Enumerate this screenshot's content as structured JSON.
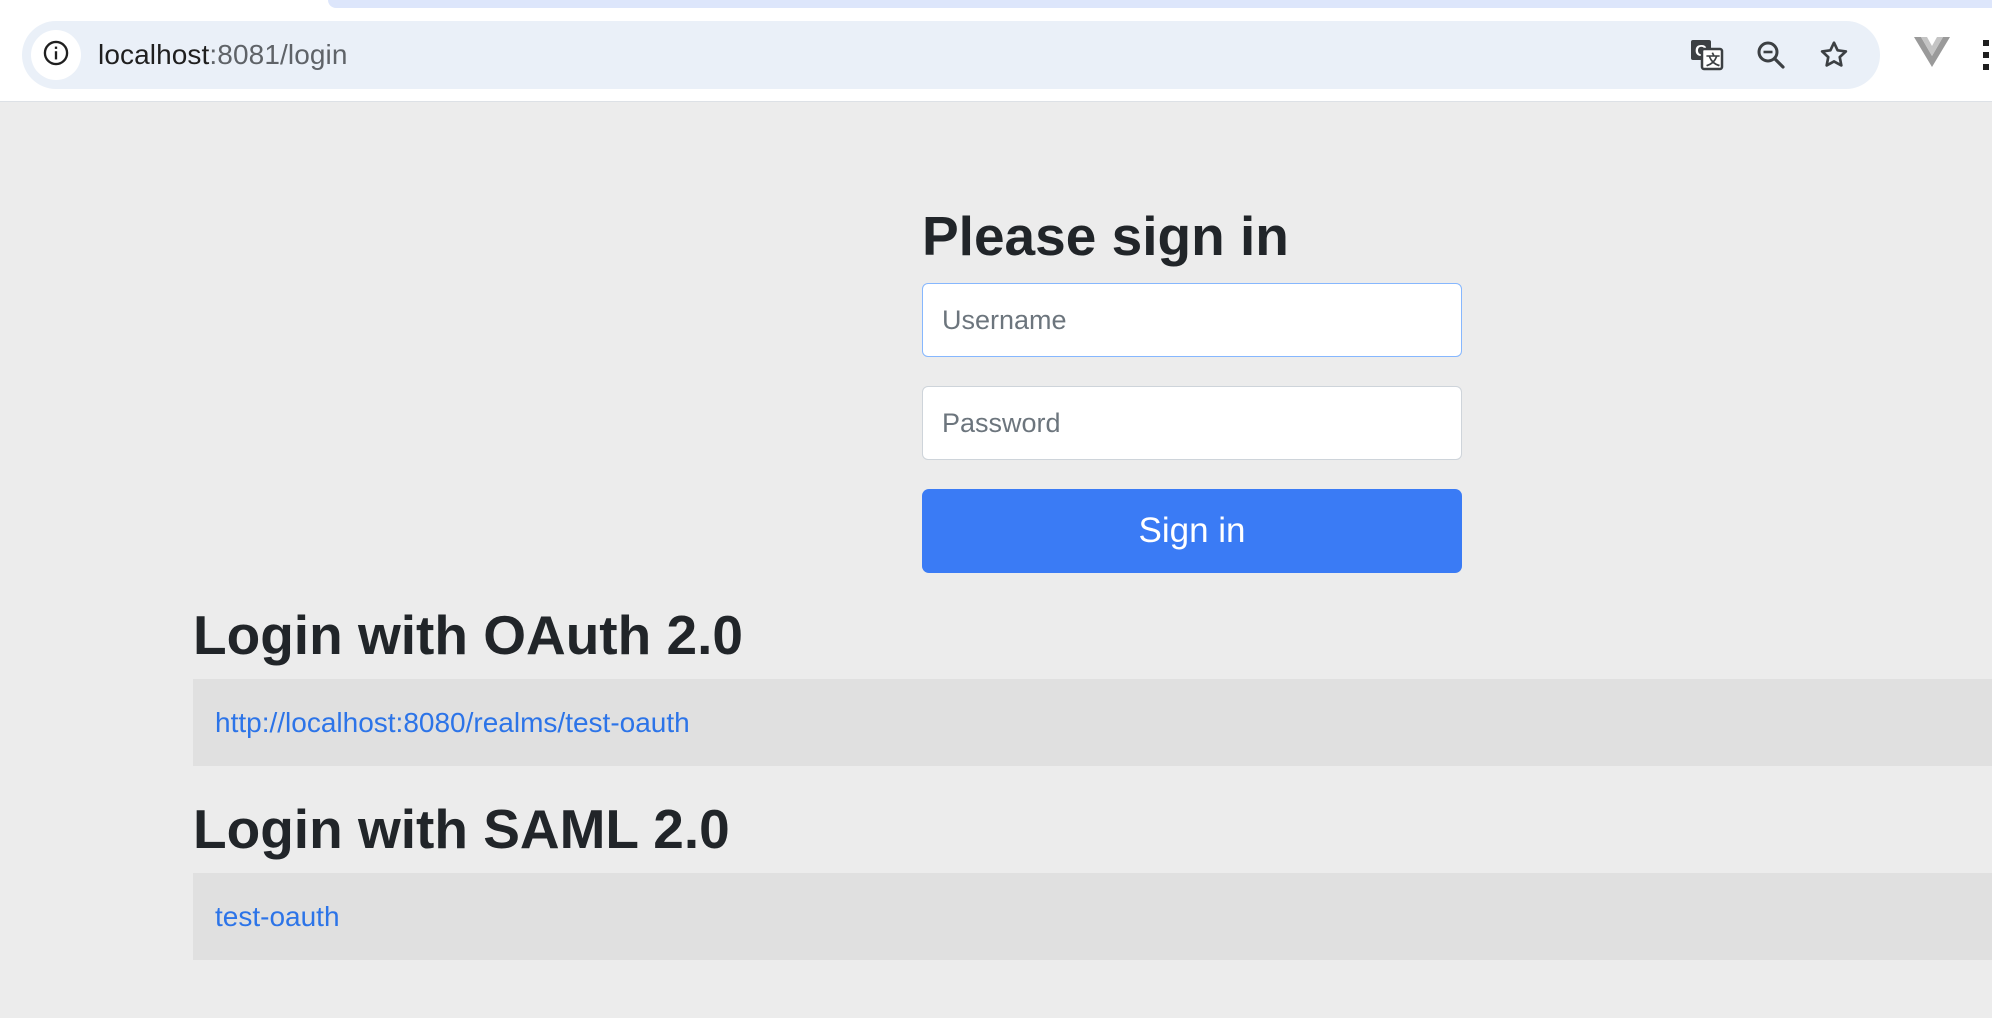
{
  "browser": {
    "url_host": "localhost",
    "url_path": ":8081/login",
    "icons": {
      "site_info": "info-icon",
      "translate": "translate-icon",
      "zoom": "zoom-out-icon",
      "bookmark": "star-icon",
      "extension": "vue-devtools-icon",
      "menu": "kebab-menu-icon"
    }
  },
  "login": {
    "heading": "Please sign in",
    "username_placeholder": "Username",
    "password_placeholder": "Password",
    "submit_label": "Sign in"
  },
  "oauth": {
    "heading": "Login with OAuth 2.0",
    "links": [
      "http://localhost:8080/realms/test-oauth"
    ]
  },
  "saml": {
    "heading": "Login with SAML 2.0",
    "links": [
      "test-oauth"
    ]
  },
  "colors": {
    "page_background": "#ececec",
    "primary_button": "#3a7bf5",
    "link": "#2c74e8",
    "table_row": "#e0e0e0"
  }
}
